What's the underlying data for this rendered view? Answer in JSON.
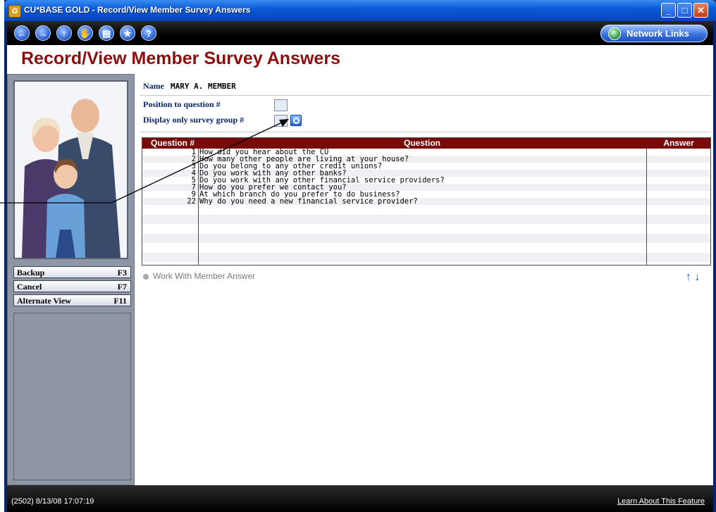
{
  "window": {
    "title": "CU*BASE GOLD - Record/View Member Survey Answers",
    "app_icon": "G",
    "minimize": "_",
    "maximize": "□",
    "close": "✕"
  },
  "toolbar": {
    "buttons": [
      {
        "icon": "back-arrow-icon",
        "glyph": "←"
      },
      {
        "icon": "forward-arrow-icon",
        "glyph": "→"
      },
      {
        "icon": "up-arrow-icon",
        "glyph": "↑"
      },
      {
        "icon": "hand-icon",
        "glyph": "✋"
      },
      {
        "icon": "printer-icon",
        "glyph": "▤"
      },
      {
        "icon": "star-icon",
        "glyph": "★"
      },
      {
        "icon": "help-icon",
        "glyph": "?"
      }
    ],
    "network_links": "Network Links"
  },
  "page": {
    "title": "Record/View Member Survey Answers"
  },
  "member": {
    "name_label": "Name",
    "name_value": "MARY A. MEMBER"
  },
  "filters": {
    "position_label": "Position to question #",
    "position_value": "",
    "group_label": "Display only survey group #",
    "group_value": ""
  },
  "table": {
    "headers": {
      "number": "Question #",
      "question": "Question",
      "answer": "Answer"
    },
    "rows": [
      {
        "n": "1",
        "q": "How did you hear about the CU"
      },
      {
        "n": "2",
        "q": "How many other people are living at your house?"
      },
      {
        "n": "3",
        "q": "Do you belong to any other credit unions?"
      },
      {
        "n": "4",
        "q": "Do you work with any other banks?"
      },
      {
        "n": "5",
        "q": "Do you work with any other financial service providers?"
      },
      {
        "n": "7",
        "q": "How do you prefer we contact you?"
      },
      {
        "n": "9",
        "q": "At which branch do you prefer to do business?"
      },
      {
        "n": "22",
        "q": "Why do you need a new financial service provider?"
      }
    ]
  },
  "actions": {
    "work_with": "Work With Member Answer"
  },
  "function_keys": [
    {
      "label": "Backup",
      "key": "F3"
    },
    {
      "label": "Cancel",
      "key": "F7"
    },
    {
      "label": "Alternate View",
      "key": "F11"
    }
  ],
  "status": {
    "left": "(2502) 8/13/08 17:07:19",
    "right": "Learn About This Feature"
  },
  "colors": {
    "heading": "#8b0f0f",
    "table_header": "#7a0a0a",
    "accent": "#1a5ad8"
  }
}
